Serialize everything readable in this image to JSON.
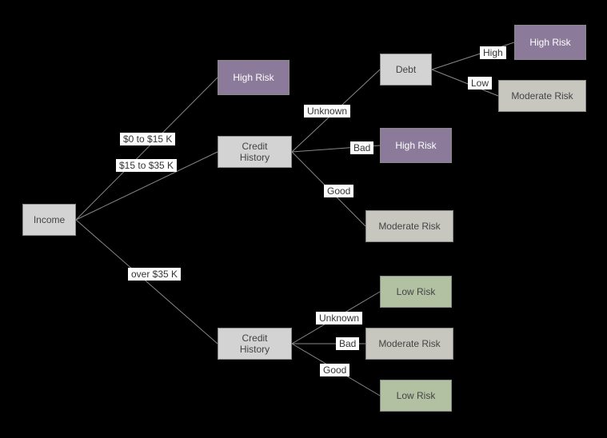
{
  "nodes": {
    "income": {
      "label": "Income"
    },
    "highrisk1": {
      "label": "High Risk"
    },
    "credit1": {
      "label": "Credit History"
    },
    "credit2": {
      "label": "Credit History"
    },
    "debt": {
      "label": "Debt"
    },
    "highrisk_debt": {
      "label": "High Risk"
    },
    "moderate_debt": {
      "label": "Moderate Risk"
    },
    "highrisk_bad": {
      "label": "High Risk"
    },
    "moderate_good": {
      "label": "Moderate Risk"
    },
    "lowrisk_unk": {
      "label": "Low Risk"
    },
    "moderate_bad": {
      "label": "Moderate Risk"
    },
    "lowrisk_good": {
      "label": "Low Risk"
    }
  },
  "edges": {
    "e_inc_hr": {
      "label": "$0 to $15 K"
    },
    "e_inc_c1": {
      "label": "$15 to $35 K"
    },
    "e_inc_c2": {
      "label": "over $35 K"
    },
    "e_c1_debt": {
      "label": "Unknown"
    },
    "e_c1_bad": {
      "label": "Bad"
    },
    "e_c1_good": {
      "label": "Good"
    },
    "e_debt_high": {
      "label": "High"
    },
    "e_debt_low": {
      "label": "Low"
    },
    "e_c2_unk": {
      "label": "Unknown"
    },
    "e_c2_bad": {
      "label": "Bad"
    },
    "e_c2_good": {
      "label": "Good"
    }
  },
  "chart_data": {
    "type": "tree",
    "root": "Income",
    "structure": {
      "Income": {
        "$0 to $15 K": "High Risk",
        "$15 to $35 K": {
          "Credit History": {
            "Unknown": {
              "Debt": {
                "High": "High Risk",
                "Low": "Moderate Risk"
              }
            },
            "Bad": "High Risk",
            "Good": "Moderate Risk"
          }
        },
        "over $35 K": {
          "Credit History": {
            "Unknown": "Low Risk",
            "Bad": "Moderate Risk",
            "Good": "Low Risk"
          }
        }
      }
    }
  }
}
